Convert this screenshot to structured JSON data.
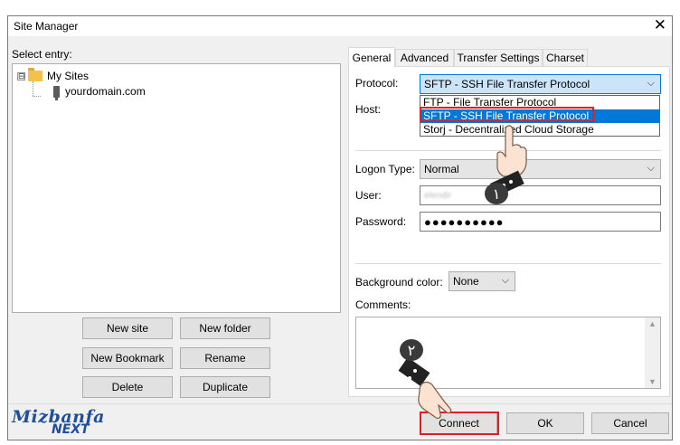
{
  "window": {
    "title": "Site Manager",
    "close_glyph": "✕"
  },
  "left": {
    "select_entry_label": "Select entry:",
    "tree": [
      {
        "label": "My Sites",
        "expander": "⊟",
        "icon": "folder-icon"
      },
      {
        "label": "yourdomain.com",
        "icon": "server-icon"
      }
    ],
    "buttons": {
      "new_site": "New site",
      "new_folder": "New folder",
      "new_bookmark": "New Bookmark",
      "rename": "Rename",
      "delete": "Delete",
      "duplicate": "Duplicate"
    }
  },
  "tabs": [
    "General",
    "Advanced",
    "Transfer Settings",
    "Charset"
  ],
  "general": {
    "protocol_label": "Protocol:",
    "protocol_value": "SFTP - SSH File Transfer Protocol",
    "protocol_options": [
      "FTP - File Transfer Protocol",
      "SFTP - SSH File Transfer Protocol",
      "Storj - Decentralized Cloud Storage"
    ],
    "host_label": "Host:",
    "logon_type_label": "Logon Type:",
    "logon_type_value": "Normal",
    "user_label": "User:",
    "user_value": "elendir",
    "password_label": "Password:",
    "password_value": "●●●●●●●●●●",
    "bg_color_label": "Background color:",
    "bg_color_value": "None",
    "comments_label": "Comments:"
  },
  "footer": {
    "connect": "Connect",
    "ok": "OK",
    "cancel": "Cancel"
  },
  "annotations": {
    "step1": "١",
    "step2": "٢"
  },
  "logo": {
    "line1": "Mizbanfa",
    "line2": "NEXT"
  },
  "colors": {
    "accent": "#0078d7",
    "highlight_box": "#e01e26",
    "logo": "#1f4e9c"
  }
}
